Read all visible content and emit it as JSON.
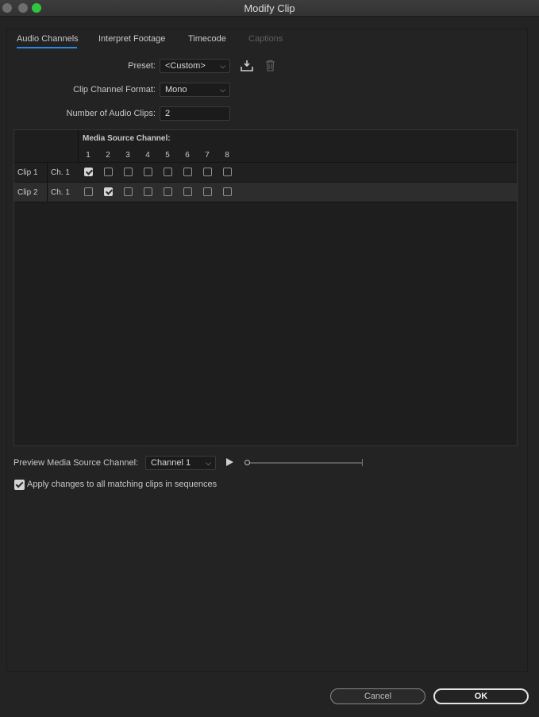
{
  "window": {
    "title": "Modify Clip"
  },
  "tabs": [
    {
      "label": "Audio Channels",
      "active": true
    },
    {
      "label": "Interpret Footage"
    },
    {
      "label": "Timecode"
    },
    {
      "label": "Captions",
      "disabled": true
    }
  ],
  "form": {
    "preset_label": "Preset:",
    "preset_value": "<Custom>",
    "format_label": "Clip Channel Format:",
    "format_value": "Mono",
    "count_label": "Number of Audio Clips:",
    "count_value": "2"
  },
  "grid": {
    "header": "Media Source Channel:",
    "columns": [
      "1",
      "2",
      "3",
      "4",
      "5",
      "6",
      "7",
      "8"
    ],
    "rows": [
      {
        "clip": "Clip 1",
        "channel": "Ch. 1",
        "checked": [
          true,
          false,
          false,
          false,
          false,
          false,
          false,
          false
        ]
      },
      {
        "clip": "Clip 2",
        "channel": "Ch. 1",
        "checked": [
          false,
          true,
          false,
          false,
          false,
          false,
          false,
          false
        ]
      }
    ]
  },
  "preview": {
    "label": "Preview Media Source Channel:",
    "value": "Channel 1"
  },
  "apply": {
    "label": "Apply changes to all matching clips in sequences",
    "checked": true
  },
  "buttons": {
    "cancel": "Cancel",
    "ok": "OK"
  },
  "colors": {
    "accent": "#2f87e0",
    "background": "#232323",
    "max_button": "#2fc53f"
  }
}
